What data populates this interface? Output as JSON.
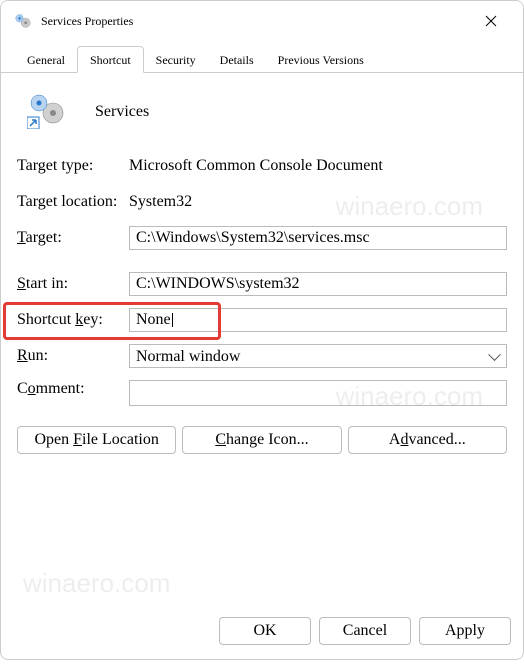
{
  "window": {
    "title": "Services Properties"
  },
  "tabs": {
    "items": [
      {
        "label": "General"
      },
      {
        "label": "Shortcut"
      },
      {
        "label": "Security"
      },
      {
        "label": "Details"
      },
      {
        "label": "Previous Versions"
      }
    ],
    "active_index": 1
  },
  "shortcut": {
    "name": "Services",
    "target_type_label": "Target type:",
    "target_type": "Microsoft Common Console Document",
    "target_location_label": "Target location:",
    "target_location": "System32",
    "target_label": "Target:",
    "target": "C:\\Windows\\System32\\services.msc",
    "start_in_label": "Start in:",
    "start_in": "C:\\WINDOWS\\system32",
    "shortcut_key_label": "Shortcut key:",
    "shortcut_key": "None",
    "run_label": "Run:",
    "run": "Normal window",
    "comment_label": "Comment:",
    "comment": "",
    "open_file_location": "Open File Location",
    "change_icon": "Change Icon...",
    "advanced": "Advanced..."
  },
  "dialog": {
    "ok": "OK",
    "cancel": "Cancel",
    "apply": "Apply"
  },
  "watermark": "winaero.com"
}
